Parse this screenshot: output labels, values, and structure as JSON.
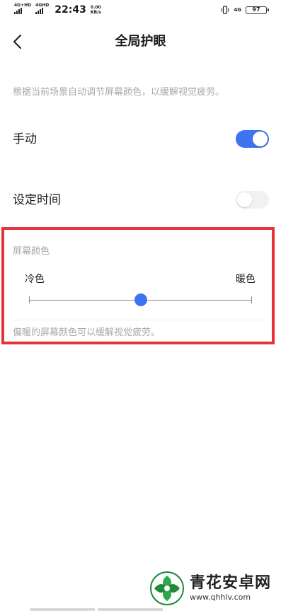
{
  "status_bar": {
    "network_1": "4G+HD",
    "network_2": "4GHD",
    "time": "22:43",
    "speed_value": "0.00",
    "speed_unit": "KB/s",
    "network_right": "4G",
    "battery": "97"
  },
  "header": {
    "back_icon": "chevron-left-icon",
    "title": "全局护眼"
  },
  "description": "根据当前场景自动调节屏幕颜色，以缓解视觉疲劳。",
  "settings": {
    "manual": {
      "label": "手动",
      "enabled": true
    },
    "schedule": {
      "label": "设定时间",
      "enabled": false
    }
  },
  "screen_color": {
    "title": "屏幕颜色",
    "cold_label": "冷色",
    "warm_label": "暖色",
    "slider_value": 0.5,
    "note": "偏暖的屏幕颜色可以缓解视觉疲劳。"
  },
  "watermark": {
    "name": "青花安卓网",
    "url": "www.qhhlv.com"
  },
  "colors": {
    "accent": "#3f74f0",
    "highlight": "#e8323a",
    "secondary_text": "#a8a8a8"
  }
}
